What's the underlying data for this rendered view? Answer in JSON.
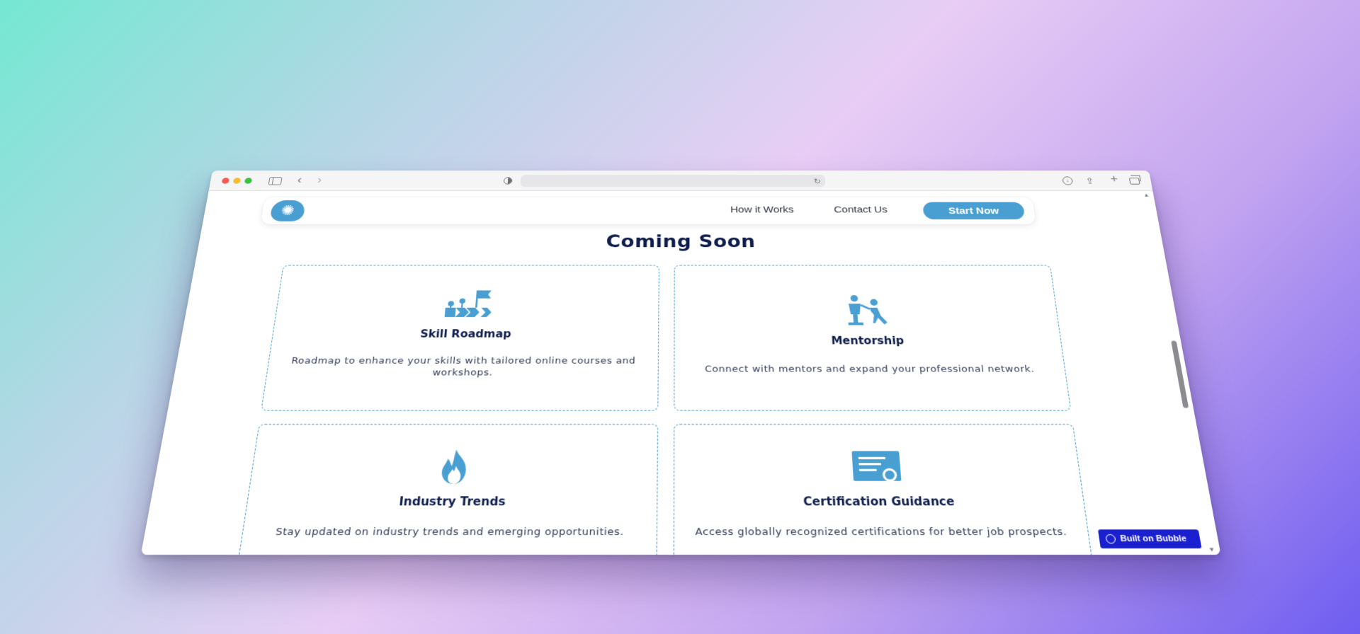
{
  "browser": {
    "reload_glyph": "↻",
    "back_glyph": "‹",
    "forward_glyph": "›",
    "plus_glyph": "+",
    "share_glyph": "⇪",
    "download_glyph": "↓"
  },
  "nav": {
    "logo_glyph": "✺",
    "links": [
      {
        "label": "How it Works"
      },
      {
        "label": "Contact Us"
      }
    ],
    "cta_label": "Start Now"
  },
  "section": {
    "title": "Coming Soon"
  },
  "cards": [
    {
      "icon": "roadmap-icon",
      "title": "Skill Roadmap",
      "description": "Roadmap to enhance your skills with tailored online courses and workshops."
    },
    {
      "icon": "mentorship-icon",
      "title": "Mentorship",
      "description": "Connect with mentors and expand your professional network."
    },
    {
      "icon": "flame-icon",
      "title": "Industry Trends",
      "description": "Stay updated on industry trends and emerging opportunities."
    },
    {
      "icon": "certificate-icon",
      "title": "Certification Guidance",
      "description": "Access globally recognized certifications for better job prospects."
    }
  ],
  "badge": {
    "label": "Built on Bubble"
  },
  "colors": {
    "accent": "#4a9fd2",
    "heading": "#0e1d4a",
    "badge": "#1a1fd0"
  }
}
